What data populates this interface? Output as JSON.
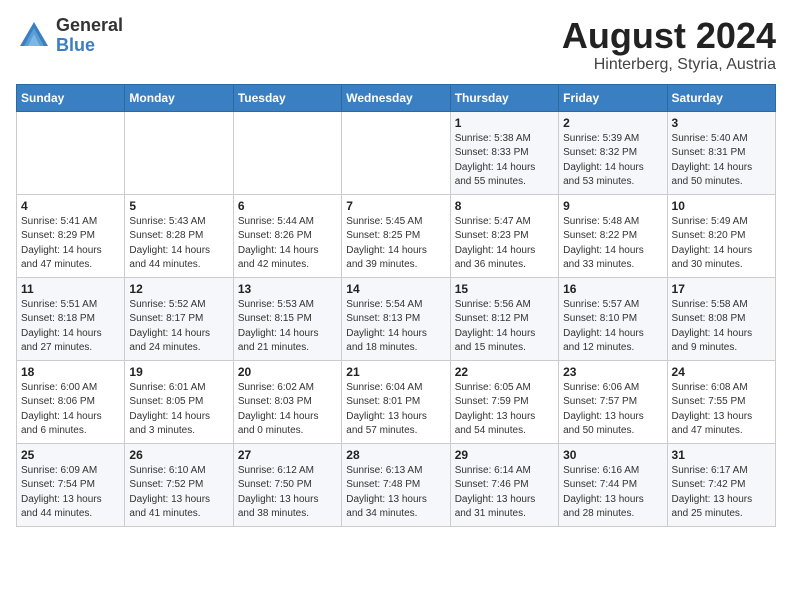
{
  "logo": {
    "general": "General",
    "blue": "Blue"
  },
  "title": "August 2024",
  "subtitle": "Hinterberg, Styria, Austria",
  "days_of_week": [
    "Sunday",
    "Monday",
    "Tuesday",
    "Wednesday",
    "Thursday",
    "Friday",
    "Saturday"
  ],
  "weeks": [
    [
      {
        "num": "",
        "info": ""
      },
      {
        "num": "",
        "info": ""
      },
      {
        "num": "",
        "info": ""
      },
      {
        "num": "",
        "info": ""
      },
      {
        "num": "1",
        "info": "Sunrise: 5:38 AM\nSunset: 8:33 PM\nDaylight: 14 hours\nand 55 minutes."
      },
      {
        "num": "2",
        "info": "Sunrise: 5:39 AM\nSunset: 8:32 PM\nDaylight: 14 hours\nand 53 minutes."
      },
      {
        "num": "3",
        "info": "Sunrise: 5:40 AM\nSunset: 8:31 PM\nDaylight: 14 hours\nand 50 minutes."
      }
    ],
    [
      {
        "num": "4",
        "info": "Sunrise: 5:41 AM\nSunset: 8:29 PM\nDaylight: 14 hours\nand 47 minutes."
      },
      {
        "num": "5",
        "info": "Sunrise: 5:43 AM\nSunset: 8:28 PM\nDaylight: 14 hours\nand 44 minutes."
      },
      {
        "num": "6",
        "info": "Sunrise: 5:44 AM\nSunset: 8:26 PM\nDaylight: 14 hours\nand 42 minutes."
      },
      {
        "num": "7",
        "info": "Sunrise: 5:45 AM\nSunset: 8:25 PM\nDaylight: 14 hours\nand 39 minutes."
      },
      {
        "num": "8",
        "info": "Sunrise: 5:47 AM\nSunset: 8:23 PM\nDaylight: 14 hours\nand 36 minutes."
      },
      {
        "num": "9",
        "info": "Sunrise: 5:48 AM\nSunset: 8:22 PM\nDaylight: 14 hours\nand 33 minutes."
      },
      {
        "num": "10",
        "info": "Sunrise: 5:49 AM\nSunset: 8:20 PM\nDaylight: 14 hours\nand 30 minutes."
      }
    ],
    [
      {
        "num": "11",
        "info": "Sunrise: 5:51 AM\nSunset: 8:18 PM\nDaylight: 14 hours\nand 27 minutes."
      },
      {
        "num": "12",
        "info": "Sunrise: 5:52 AM\nSunset: 8:17 PM\nDaylight: 14 hours\nand 24 minutes."
      },
      {
        "num": "13",
        "info": "Sunrise: 5:53 AM\nSunset: 8:15 PM\nDaylight: 14 hours\nand 21 minutes."
      },
      {
        "num": "14",
        "info": "Sunrise: 5:54 AM\nSunset: 8:13 PM\nDaylight: 14 hours\nand 18 minutes."
      },
      {
        "num": "15",
        "info": "Sunrise: 5:56 AM\nSunset: 8:12 PM\nDaylight: 14 hours\nand 15 minutes."
      },
      {
        "num": "16",
        "info": "Sunrise: 5:57 AM\nSunset: 8:10 PM\nDaylight: 14 hours\nand 12 minutes."
      },
      {
        "num": "17",
        "info": "Sunrise: 5:58 AM\nSunset: 8:08 PM\nDaylight: 14 hours\nand 9 minutes."
      }
    ],
    [
      {
        "num": "18",
        "info": "Sunrise: 6:00 AM\nSunset: 8:06 PM\nDaylight: 14 hours\nand 6 minutes."
      },
      {
        "num": "19",
        "info": "Sunrise: 6:01 AM\nSunset: 8:05 PM\nDaylight: 14 hours\nand 3 minutes."
      },
      {
        "num": "20",
        "info": "Sunrise: 6:02 AM\nSunset: 8:03 PM\nDaylight: 14 hours\nand 0 minutes."
      },
      {
        "num": "21",
        "info": "Sunrise: 6:04 AM\nSunset: 8:01 PM\nDaylight: 13 hours\nand 57 minutes."
      },
      {
        "num": "22",
        "info": "Sunrise: 6:05 AM\nSunset: 7:59 PM\nDaylight: 13 hours\nand 54 minutes."
      },
      {
        "num": "23",
        "info": "Sunrise: 6:06 AM\nSunset: 7:57 PM\nDaylight: 13 hours\nand 50 minutes."
      },
      {
        "num": "24",
        "info": "Sunrise: 6:08 AM\nSunset: 7:55 PM\nDaylight: 13 hours\nand 47 minutes."
      }
    ],
    [
      {
        "num": "25",
        "info": "Sunrise: 6:09 AM\nSunset: 7:54 PM\nDaylight: 13 hours\nand 44 minutes."
      },
      {
        "num": "26",
        "info": "Sunrise: 6:10 AM\nSunset: 7:52 PM\nDaylight: 13 hours\nand 41 minutes."
      },
      {
        "num": "27",
        "info": "Sunrise: 6:12 AM\nSunset: 7:50 PM\nDaylight: 13 hours\nand 38 minutes."
      },
      {
        "num": "28",
        "info": "Sunrise: 6:13 AM\nSunset: 7:48 PM\nDaylight: 13 hours\nand 34 minutes."
      },
      {
        "num": "29",
        "info": "Sunrise: 6:14 AM\nSunset: 7:46 PM\nDaylight: 13 hours\nand 31 minutes."
      },
      {
        "num": "30",
        "info": "Sunrise: 6:16 AM\nSunset: 7:44 PM\nDaylight: 13 hours\nand 28 minutes."
      },
      {
        "num": "31",
        "info": "Sunrise: 6:17 AM\nSunset: 7:42 PM\nDaylight: 13 hours\nand 25 minutes."
      }
    ]
  ]
}
